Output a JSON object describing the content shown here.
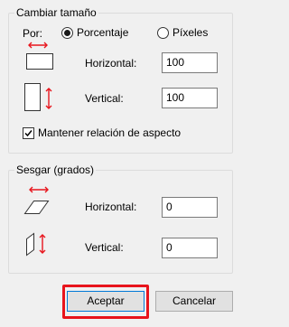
{
  "resize": {
    "title": "Cambiar tamaño",
    "by_label": "Por:",
    "options": [
      "Porcentaje",
      "Píxeles"
    ],
    "selected": "Porcentaje",
    "horizontal_label": "Horizontal:",
    "horizontal_value": "100",
    "vertical_label": "Vertical:",
    "vertical_value": "100",
    "keep_aspect_label": "Mantener relación de aspecto",
    "keep_aspect_checked": true
  },
  "skew": {
    "title": "Sesgar (grados)",
    "horizontal_label": "Horizontal:",
    "horizontal_value": "0",
    "vertical_label": "Vertical:",
    "vertical_value": "0"
  },
  "buttons": {
    "ok_label": "Aceptar",
    "cancel_label": "Cancelar"
  },
  "colors": {
    "arrow": "#e8141c",
    "highlight": "#e8141c",
    "default_button_border": "#0078d7"
  },
  "icons": [
    "resize-horizontal-icon",
    "resize-vertical-icon",
    "skew-horizontal-icon",
    "skew-vertical-icon",
    "checkmark-icon"
  ]
}
